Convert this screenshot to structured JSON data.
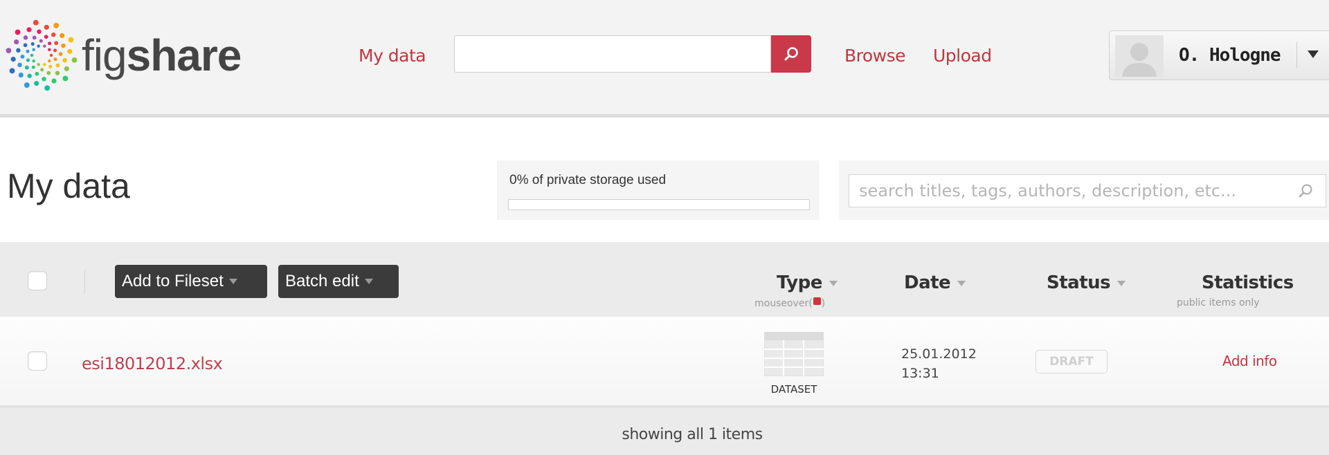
{
  "header": {
    "logo_text_fig": "fig",
    "logo_text_share": "share",
    "nav": {
      "my_data": "My data",
      "browse": "Browse",
      "upload": "Upload"
    },
    "search": {
      "value": "",
      "placeholder": ""
    },
    "user": {
      "name": "O. Hologne"
    }
  },
  "page": {
    "title": "My data",
    "storage": {
      "label": "0% of private storage used",
      "used_fraction": 0
    },
    "search": {
      "placeholder": "search titles, tags, authors, description, etc..."
    }
  },
  "table": {
    "actions": {
      "add_to_fileset": "Add to Fileset",
      "batch_edit": "Batch edit"
    },
    "columns": {
      "type": "Type",
      "type_sub_pre": "mouseover(",
      "type_sub_post": ")",
      "date": "Date",
      "status": "Status",
      "statistics": "Statistics",
      "statistics_sub": "public items only"
    },
    "rows": [
      {
        "filename": "esi18012012.xlsx",
        "type": "DATASET",
        "date": "25.01.2012",
        "time": "13:31",
        "status": "DRAFT",
        "statistics": "Add info"
      }
    ],
    "footer": "showing all 1 items"
  },
  "colors": {
    "accent": "#c1363f",
    "search_button": "#c9394a",
    "dark_button": "#3b3b3b"
  },
  "icons": {
    "logo": "figshare-logo-icon",
    "search": "search-icon",
    "caret": "chevron-down-icon",
    "dataset": "dataset-table-icon"
  }
}
